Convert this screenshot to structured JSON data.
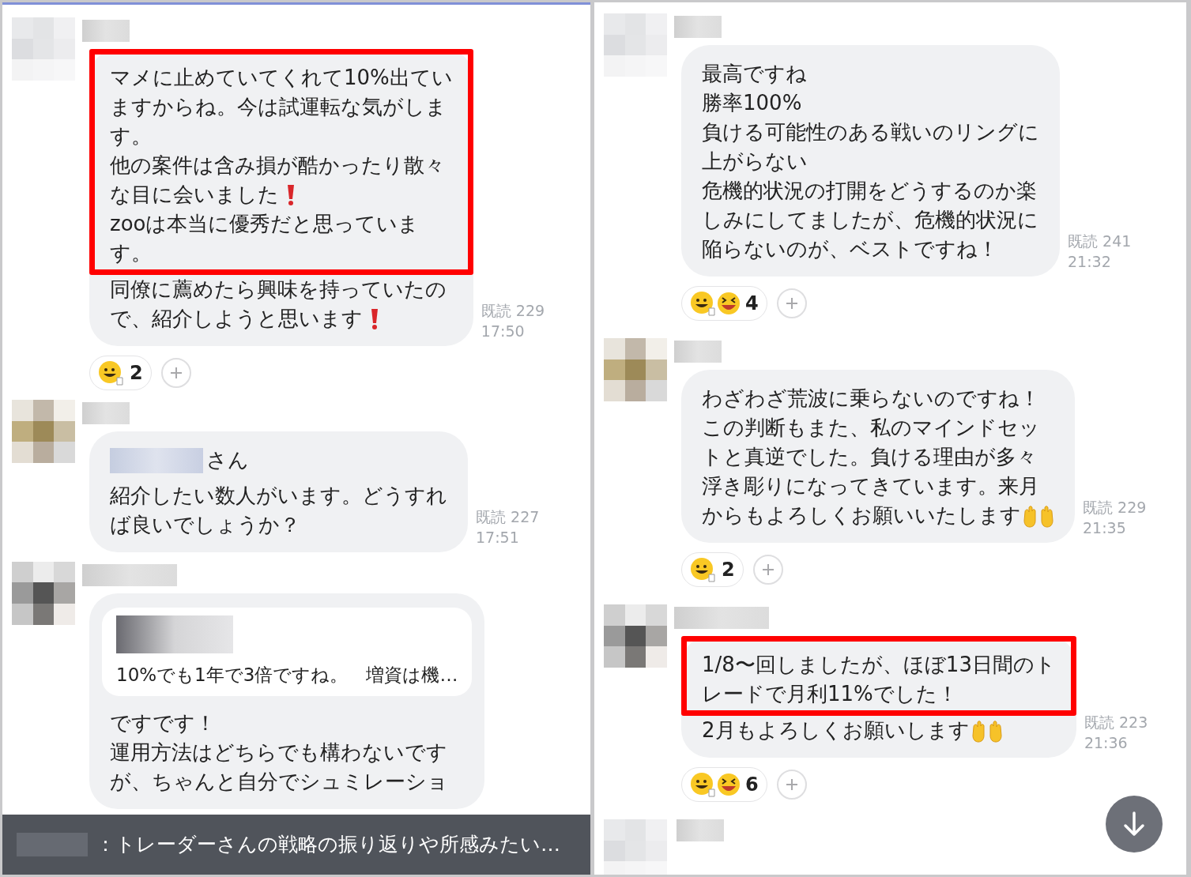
{
  "left_panel": {
    "messages": [
      {
        "kind": "text",
        "blocks": [
          {
            "highlighted": true,
            "lines": [
              "マメに止めていてくれて10%出てい",
              "ますからね。今は試運転な気がしま",
              "す。",
              "他の案件は含み損が酷かったり散々",
              {
                "kind": "exclamation",
                "text": "な目に会いました"
              },
              "zooは本当に優秀だと思っていま",
              "す。"
            ]
          },
          {
            "highlighted": false,
            "lines": [
              "同僚に薦めたら興味を持っていたの",
              {
                "kind": "exclamation",
                "text": "で、紹介しようと思います"
              }
            ]
          }
        ],
        "read": "既読 229",
        "time": "17:50",
        "reaction": {
          "kind": "single",
          "count": "2"
        }
      },
      {
        "kind": "text",
        "blocks": [
          {
            "highlighted": false,
            "lines": [
              {
                "kind": "mention",
                "text": "さん"
              },
              "紹介したい数人がいます。どうすれ",
              "ば良いでしょうか？"
            ]
          }
        ],
        "read": "既読 227",
        "time": "17:51"
      },
      {
        "kind": "text",
        "quote": {
          "text": "10%でも1年で3倍ですね。　増資は機…"
        },
        "blocks": [
          {
            "highlighted": false,
            "lines": [
              "ですです！",
              "運用方法はどちらでも構わないです",
              "が、ちゃんと自分でシュミレーショ"
            ]
          }
        ]
      }
    ],
    "notification": {
      "text": "：トレーダーさんの戦略の振り返りや所感みたい…"
    }
  },
  "right_panel": {
    "messages": [
      {
        "kind": "text",
        "blocks": [
          {
            "highlighted": false,
            "lines": [
              "最高ですね",
              "勝率100%",
              "負ける可能性のある戦いのリングに",
              "上がらない",
              "危機的状況の打開をどうするのか楽",
              "しみにしてましたが、危機的状況に",
              "陥らないのが、ベストですね！"
            ]
          }
        ],
        "read": "既読 241",
        "time": "21:32",
        "reaction": {
          "kind": "pair",
          "count": "4"
        }
      },
      {
        "kind": "text",
        "blocks": [
          {
            "highlighted": false,
            "lines": [
              "わざわざ荒波に乗らないのですね！",
              "この判断もまた、私のマインドセッ",
              "トと真逆でした。負ける理由が多々",
              "浮き彫りになってきています。来月",
              {
                "kind": "palms",
                "text": "からもよろしくお願いいたします"
              }
            ]
          }
        ],
        "read": "既読 229",
        "time": "21:35",
        "reaction": {
          "kind": "single",
          "count": "2"
        }
      },
      {
        "kind": "text",
        "blocks": [
          {
            "highlighted": true,
            "lines": [
              "1/8〜回しましたが、ほぼ13日間のト",
              "レードで月利11%でした！"
            ]
          },
          {
            "highlighted": false,
            "lines": [
              {
                "kind": "palms",
                "text": "2月もよろしくお願いします"
              }
            ]
          }
        ],
        "read": "既読 223",
        "time": "21:36",
        "reaction": {
          "kind": "pair",
          "count": "6"
        }
      },
      {
        "kind": "cut"
      }
    ],
    "scroll_down": true
  }
}
